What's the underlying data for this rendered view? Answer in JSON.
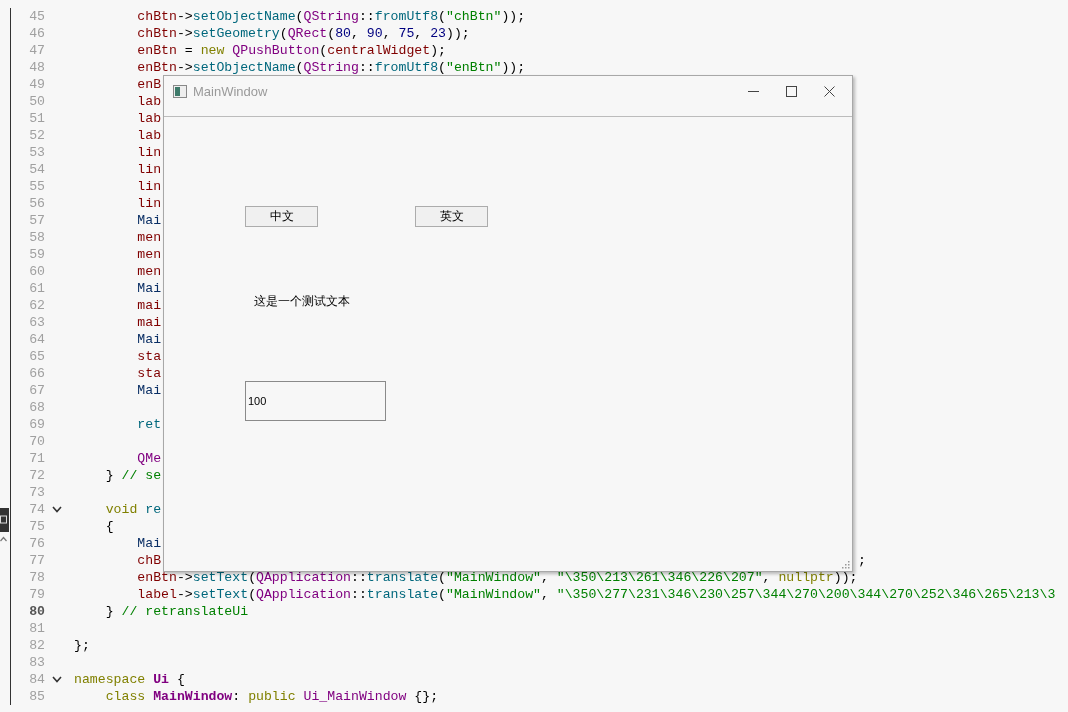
{
  "editor": {
    "lines": [
      {
        "number": "45",
        "current": false,
        "code": [
          {
            "text": "        chBtn",
            "kind": "var"
          },
          {
            "text": "->",
            "kind": "punct"
          },
          {
            "text": "setObjectName",
            "kind": "func"
          },
          {
            "text": "(",
            "kind": "punct"
          },
          {
            "text": "QString",
            "kind": "type"
          },
          {
            "text": "::",
            "kind": "punct"
          },
          {
            "text": "fromUtf8",
            "kind": "func"
          },
          {
            "text": "(",
            "kind": "punct"
          },
          {
            "text": "\"chBtn\"",
            "kind": "str"
          },
          {
            "text": "));",
            "kind": "punct"
          }
        ]
      },
      {
        "number": "46",
        "current": false,
        "code": [
          {
            "text": "        chBtn",
            "kind": "var"
          },
          {
            "text": "->",
            "kind": "punct"
          },
          {
            "text": "setGeometry",
            "kind": "func"
          },
          {
            "text": "(",
            "kind": "punct"
          },
          {
            "text": "QRect",
            "kind": "type"
          },
          {
            "text": "(",
            "kind": "punct"
          },
          {
            "text": "80",
            "kind": "num"
          },
          {
            "text": ", ",
            "kind": "punct"
          },
          {
            "text": "90",
            "kind": "num"
          },
          {
            "text": ", ",
            "kind": "punct"
          },
          {
            "text": "75",
            "kind": "num"
          },
          {
            "text": ", ",
            "kind": "punct"
          },
          {
            "text": "23",
            "kind": "num"
          },
          {
            "text": "));",
            "kind": "punct"
          }
        ]
      },
      {
        "number": "47",
        "current": false,
        "code": [
          {
            "text": "        enBtn",
            "kind": "var"
          },
          {
            "text": " = ",
            "kind": "punct"
          },
          {
            "text": "new",
            "kind": "kw"
          },
          {
            "text": " QPushButton",
            "kind": "type"
          },
          {
            "text": "(",
            "kind": "punct"
          },
          {
            "text": "centralWidget",
            "kind": "var"
          },
          {
            "text": ");",
            "kind": "punct"
          }
        ]
      },
      {
        "number": "48",
        "current": false,
        "code": [
          {
            "text": "        enBtn",
            "kind": "var"
          },
          {
            "text": "->",
            "kind": "punct"
          },
          {
            "text": "setObjectName",
            "kind": "func"
          },
          {
            "text": "(",
            "kind": "punct"
          },
          {
            "text": "QString",
            "kind": "type"
          },
          {
            "text": "::",
            "kind": "punct"
          },
          {
            "text": "fromUtf8",
            "kind": "func"
          },
          {
            "text": "(",
            "kind": "punct"
          },
          {
            "text": "\"enBtn\"",
            "kind": "str"
          },
          {
            "text": "));",
            "kind": "punct"
          }
        ]
      },
      {
        "number": "49",
        "current": false,
        "code": [
          {
            "text": "        enB",
            "kind": "var"
          }
        ]
      },
      {
        "number": "50",
        "current": false,
        "code": [
          {
            "text": "        lab",
            "kind": "var"
          }
        ]
      },
      {
        "number": "51",
        "current": false,
        "code": [
          {
            "text": "        lab",
            "kind": "var"
          }
        ]
      },
      {
        "number": "52",
        "current": false,
        "code": [
          {
            "text": "        lab",
            "kind": "var"
          }
        ]
      },
      {
        "number": "53",
        "current": false,
        "code": [
          {
            "text": "        lin",
            "kind": "var"
          }
        ]
      },
      {
        "number": "54",
        "current": false,
        "code": [
          {
            "text": "        lin",
            "kind": "var"
          }
        ]
      },
      {
        "number": "55",
        "current": false,
        "code": [
          {
            "text": "        lin",
            "kind": "var"
          }
        ]
      },
      {
        "number": "56",
        "current": false,
        "code": [
          {
            "text": "        lin",
            "kind": "var"
          }
        ]
      },
      {
        "number": "57",
        "current": false,
        "code": [
          {
            "text": "        Mai",
            "kind": "field"
          }
        ]
      },
      {
        "number": "58",
        "current": false,
        "code": [
          {
            "text": "        men",
            "kind": "var"
          }
        ]
      },
      {
        "number": "59",
        "current": false,
        "code": [
          {
            "text": "        men",
            "kind": "var"
          }
        ]
      },
      {
        "number": "60",
        "current": false,
        "code": [
          {
            "text": "        men",
            "kind": "var"
          }
        ]
      },
      {
        "number": "61",
        "current": false,
        "code": [
          {
            "text": "        Mai",
            "kind": "field"
          }
        ]
      },
      {
        "number": "62",
        "current": false,
        "code": [
          {
            "text": "        mai",
            "kind": "var"
          }
        ]
      },
      {
        "number": "63",
        "current": false,
        "code": [
          {
            "text": "        mai",
            "kind": "var"
          }
        ]
      },
      {
        "number": "64",
        "current": false,
        "code": [
          {
            "text": "        Mai",
            "kind": "field"
          }
        ]
      },
      {
        "number": "65",
        "current": false,
        "code": [
          {
            "text": "        sta",
            "kind": "var"
          }
        ]
      },
      {
        "number": "66",
        "current": false,
        "code": [
          {
            "text": "        sta",
            "kind": "var"
          }
        ]
      },
      {
        "number": "67",
        "current": false,
        "code": [
          {
            "text": "        Mai",
            "kind": "field"
          }
        ]
      },
      {
        "number": "68",
        "current": false
      },
      {
        "number": "69",
        "current": false,
        "code": [
          {
            "text": "        ret",
            "kind": "func"
          }
        ]
      },
      {
        "number": "70",
        "current": false
      },
      {
        "number": "71",
        "current": false,
        "code": [
          {
            "text": "        QMe",
            "kind": "type"
          }
        ]
      },
      {
        "number": "72",
        "current": false,
        "code": [
          {
            "text": "    } ",
            "kind": "punct"
          },
          {
            "text": "// se",
            "kind": "comment"
          }
        ]
      },
      {
        "number": "73",
        "current": false
      },
      {
        "number": "74",
        "current": false,
        "expanded": true,
        "code": [
          {
            "text": "    void",
            "kind": "kw"
          },
          {
            "text": " re",
            "kind": "func"
          }
        ]
      },
      {
        "number": "75",
        "current": false,
        "code": [
          {
            "text": "    {",
            "kind": "punct"
          }
        ]
      },
      {
        "number": "76",
        "current": false,
        "code": [
          {
            "text": "        Mai",
            "kind": "field"
          }
        ]
      },
      {
        "number": "77",
        "current": false,
        "code": [
          {
            "text": "        chB",
            "kind": "var"
          }
        ],
        "after_window": [
          {
            "text": ";",
            "kind": "punct"
          }
        ]
      },
      {
        "number": "78",
        "current": false,
        "code": [
          {
            "text": "        enBtn",
            "kind": "var"
          },
          {
            "text": "->",
            "kind": "punct"
          },
          {
            "text": "setText",
            "kind": "func"
          },
          {
            "text": "(",
            "kind": "punct"
          },
          {
            "text": "QApplication",
            "kind": "type"
          },
          {
            "text": "::",
            "kind": "punct"
          },
          {
            "text": "translate",
            "kind": "func"
          },
          {
            "text": "(",
            "kind": "punct"
          },
          {
            "text": "\"MainWindow\"",
            "kind": "str"
          },
          {
            "text": ", ",
            "kind": "punct"
          },
          {
            "text": "\"\\350\\213\\261\\346\\226\\207\"",
            "kind": "str"
          },
          {
            "text": ", ",
            "kind": "punct"
          },
          {
            "text": "nullptr",
            "kind": "kw"
          },
          {
            "text": "));",
            "kind": "punct"
          }
        ]
      },
      {
        "number": "79",
        "current": false,
        "code": [
          {
            "text": "        label",
            "kind": "var"
          },
          {
            "text": "->",
            "kind": "punct"
          },
          {
            "text": "setText",
            "kind": "func"
          },
          {
            "text": "(",
            "kind": "punct"
          },
          {
            "text": "QApplication",
            "kind": "type"
          },
          {
            "text": "::",
            "kind": "punct"
          },
          {
            "text": "translate",
            "kind": "func"
          },
          {
            "text": "(",
            "kind": "punct"
          },
          {
            "text": "\"MainWindow\"",
            "kind": "str"
          },
          {
            "text": ", ",
            "kind": "punct"
          },
          {
            "text": "\"\\350\\277\\231\\346\\230\\257\\344\\270\\200\\344\\270\\252\\346\\265\\213\\3",
            "kind": "str"
          }
        ]
      },
      {
        "number": "80",
        "current": true,
        "code": [
          {
            "text": "    } ",
            "kind": "punct"
          },
          {
            "text": "// retranslateUi",
            "kind": "comment"
          }
        ]
      },
      {
        "number": "81",
        "current": false
      },
      {
        "number": "82",
        "current": false,
        "code": [
          {
            "text": "};",
            "kind": "punct"
          }
        ]
      },
      {
        "number": "83",
        "current": false
      },
      {
        "number": "84",
        "current": false,
        "expanded": true,
        "code": [
          {
            "text": "namespace",
            "kind": "kw"
          },
          {
            "text": " Ui",
            "kind": "class"
          },
          {
            "text": " {",
            "kind": "punct"
          }
        ]
      },
      {
        "number": "85",
        "current": false,
        "code": [
          {
            "text": "    class",
            "kind": "kw"
          },
          {
            "text": " MainWindow",
            "kind": "class"
          },
          {
            "text": ": ",
            "kind": "punct"
          },
          {
            "text": "public",
            "kind": "kw"
          },
          {
            "text": " Ui_MainWindow",
            "kind": "type"
          },
          {
            "text": " {};",
            "kind": "punct"
          }
        ]
      }
    ]
  },
  "window": {
    "title": "MainWindow",
    "buttons": [
      {
        "label": "中文"
      },
      {
        "label": "英文"
      }
    ],
    "label": "这是一个测试文本",
    "field": {
      "value": "100"
    }
  }
}
